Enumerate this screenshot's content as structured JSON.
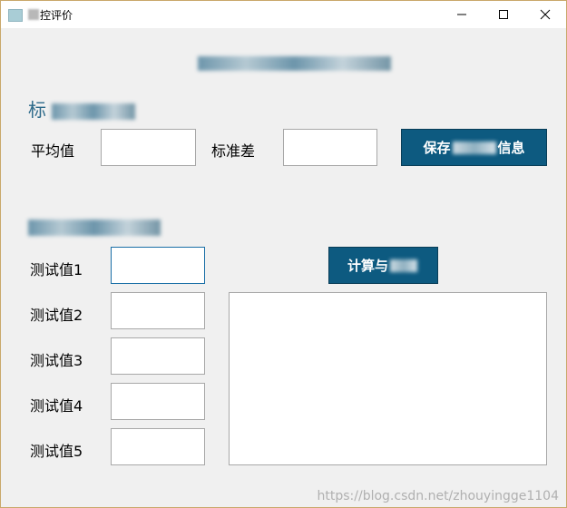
{
  "window": {
    "title": "控评价",
    "controls": {
      "minimize": "minimize-icon",
      "maximize": "maximize-icon",
      "close": "close-icon"
    }
  },
  "section_standard": {
    "title": "标",
    "mean_label": "平均值",
    "mean_value": "",
    "std_label": "标准差",
    "std_value": "",
    "save_button": {
      "prefix": "保存",
      "suffix": "信息"
    }
  },
  "section_test": {
    "title": "",
    "test_labels": [
      "测试值1",
      "测试值2",
      "测试值3",
      "测试值4",
      "测试值5"
    ],
    "test_values": [
      "",
      "",
      "",
      "",
      ""
    ],
    "calc_button": {
      "prefix": "计算与"
    },
    "output_text": ""
  },
  "watermark": "https://blog.csdn.net/zhouyingge1104",
  "colors": {
    "accent": "#0d5a80",
    "section_title": "#2d6a8a",
    "window_border": "#c9a86a"
  }
}
